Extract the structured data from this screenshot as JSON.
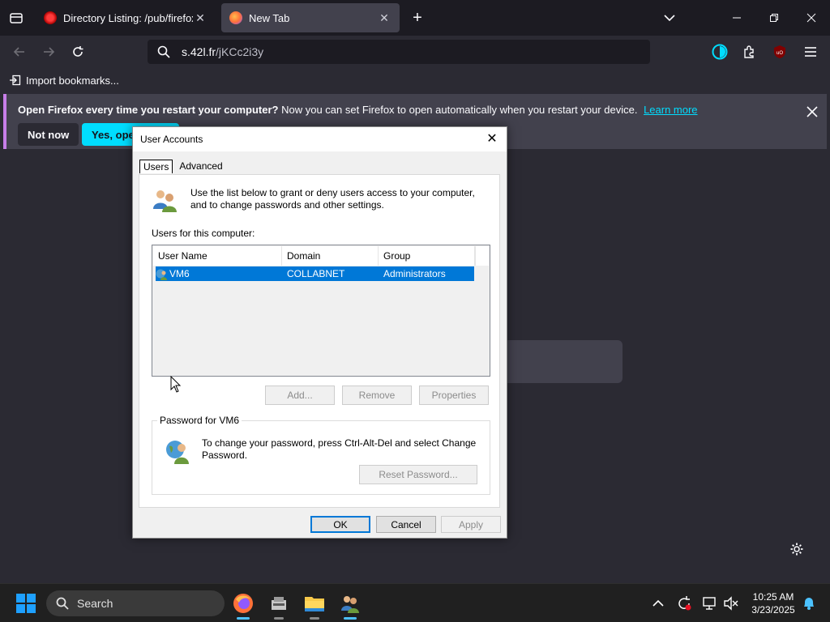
{
  "browser": {
    "tabs": [
      {
        "title": "Directory Listing: /pub/firefox/r",
        "active": false
      },
      {
        "title": "New Tab",
        "active": true
      }
    ],
    "url_main": "s.42l.fr",
    "url_path": "/jKCc2i3y",
    "bookmarks_label": "Import bookmarks...",
    "notification": {
      "bold": "Open Firefox every time you restart your computer?",
      "text": "Now you can set Firefox to open automatically when you restart your device.",
      "link": "Learn more",
      "not_now": "Not now",
      "yes_open": "Yes, open"
    },
    "colors": {
      "accent": "#00ddff",
      "tab_bg": "#42414d",
      "page_bg": "#2b2a33"
    }
  },
  "dialog": {
    "title": "User Accounts",
    "tabs": [
      "Users",
      "Advanced"
    ],
    "intro": "Use the list below to grant or deny users access to your computer, and to change passwords and other settings.",
    "users_label": "Users for this computer:",
    "columns": [
      "User Name",
      "Domain",
      "Group"
    ],
    "rows": [
      {
        "name": "VM6",
        "domain": "COLLABNET",
        "group": "Administrators"
      }
    ],
    "buttons": {
      "add": "Add...",
      "remove": "Remove",
      "properties": "Properties"
    },
    "password_group": "Password for VM6",
    "password_text": "To change your password, press Ctrl-Alt-Del and select Change Password.",
    "reset_password": "Reset Password...",
    "ok": "OK",
    "cancel": "Cancel",
    "apply": "Apply",
    "selection_color": "#0078d7"
  },
  "taskbar": {
    "search_placeholder": "Search",
    "time": "10:25 AM",
    "date": "3/23/2025"
  }
}
